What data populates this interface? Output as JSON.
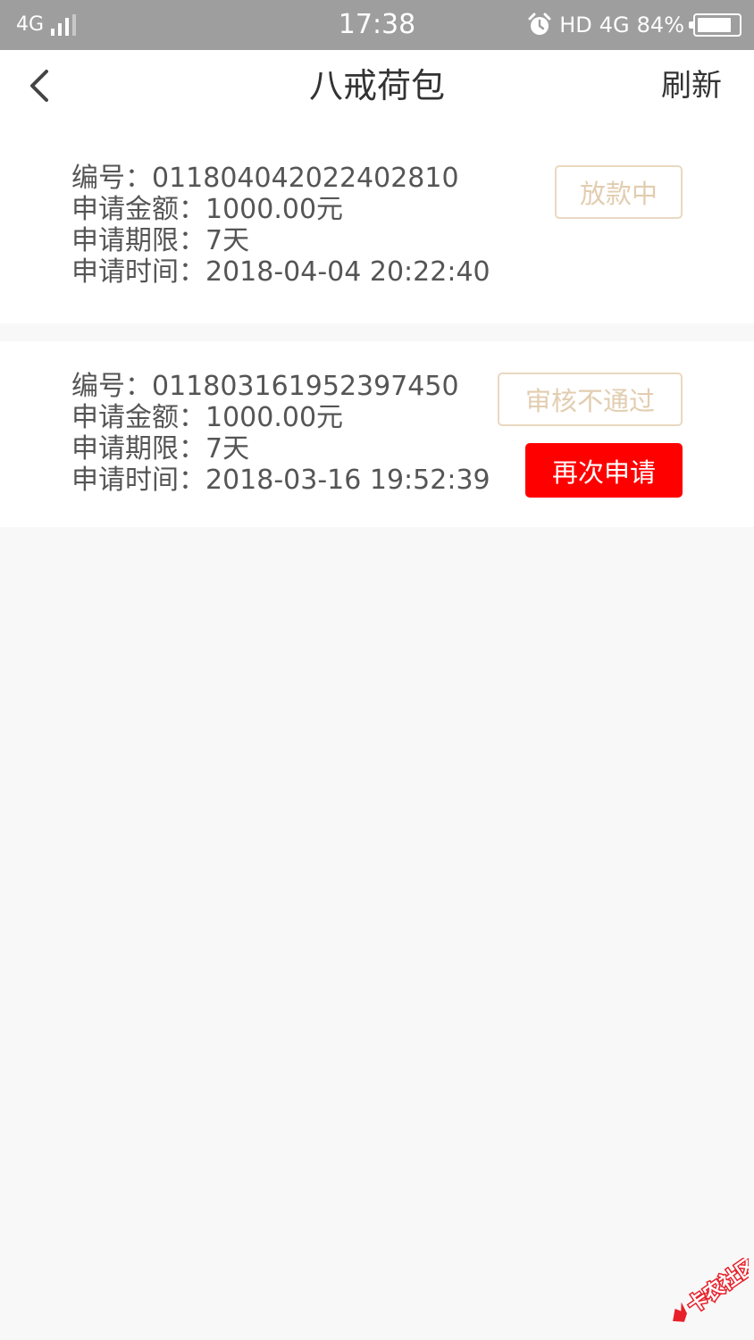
{
  "status_bar": {
    "network": "4G",
    "time": "17:38",
    "hd": "HD",
    "network_right": "4G",
    "battery_text": "84%",
    "battery_level": 0.84,
    "icons": [
      "signal-icon",
      "alarm-icon",
      "battery-icon"
    ]
  },
  "nav": {
    "back_icon": "chevron-left-icon",
    "title": "八戒荷包",
    "refresh_label": "刷新"
  },
  "orders": [
    {
      "id_label": "编号：",
      "id": "011804042022402810",
      "amount_label": "申请金额：",
      "amount": "1000.00元",
      "term_label": "申请期限：",
      "term": "7天",
      "time_label": "申请时间：",
      "time": "2018-04-04 20:22:40",
      "status": "放款中"
    },
    {
      "id_label": "编号：",
      "id": "011803161952397450",
      "amount_label": "申请金额：",
      "amount": "1000.00元",
      "term_label": "申请期限：",
      "term": "7天",
      "time_label": "申请时间：",
      "time": "2018-03-16 19:52:39",
      "status": "审核不通过",
      "action_label": "再次申请"
    }
  ],
  "watermark": {
    "text": "卡农社区",
    "icon": "kanong-logo-icon"
  },
  "colors": {
    "status_bar_bg": "#9e9e9e",
    "background": "#f8f8f8",
    "status_tag_border": "#ead8c0",
    "status_tag_text": "#e2cdb0",
    "primary_button": "#ff0000"
  }
}
